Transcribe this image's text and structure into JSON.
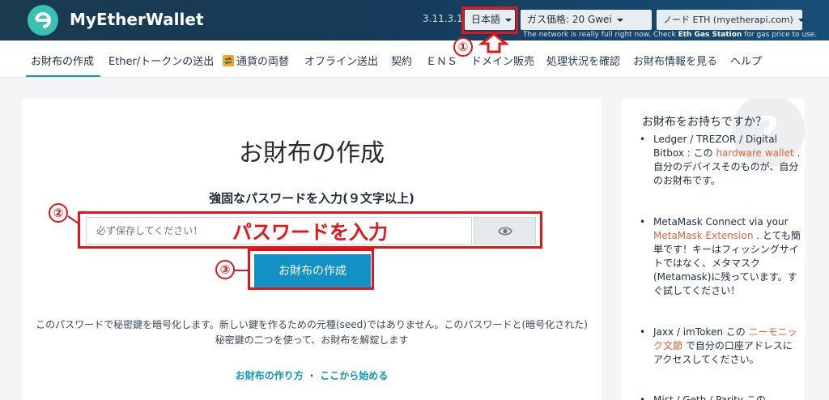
{
  "header": {
    "brand": "MyEtherWallet",
    "version": "3.11.3.1",
    "language": "日本語",
    "gas_price": "ガス価格: 20 Gwei",
    "node": "ノード ETH (myetherapi.com)",
    "gas_note_prefix": "The network is really full right now. Check ",
    "gas_note_link": "Eth Gas Station",
    "gas_note_suffix": " for gas price to use."
  },
  "nav": {
    "items": [
      "お財布の作成",
      "Ether/トークンの送出",
      "通貨の両替",
      "オフライン送出",
      "契約",
      "ＥＮＳ",
      "ドメイン販売",
      "処理状況を確認",
      "お財布情報を見る",
      "ヘルプ"
    ]
  },
  "main": {
    "title": "お財布の作成",
    "password_label": "強固なパスワードを入力(９文字以上)",
    "password_placeholder": "必ず保存してください！",
    "create_button": "お財布の作成",
    "description": "このパスワードで秘密鍵を暗号化します。新しい鍵を作るための元種(seed)ではありません。このパスワードと(暗号化された)秘密鍵の二つを使って、お財布を解錠します",
    "link_howto": "お財布の作り方",
    "link_separator": "·",
    "link_start": "ここから始める"
  },
  "annotations": {
    "num1": "①",
    "num2": "②",
    "num3": "③",
    "password_note": "パスワードを入力"
  },
  "sidebar": {
    "question_mark": "?",
    "title": "お財布をお持ちですか？",
    "bullet": "•",
    "item1_pre": "Ledger / TREZOR / Digital Bitbox : この ",
    "item1_link": "hardware wallet",
    "item1_post": " . 自分のデバイスそのものが、自分のお財布です。",
    "item2_pre": "MetaMask Connect via your ",
    "item2_link": "MetaMask Extension",
    "item2_post": " . とても簡単です！キーはフィッシングサイトではなく、メタマスク(Metamask)に残っています。すぐ試してください！",
    "item3_pre": "Jaxx / imToken この ",
    "item3_link": "ニーモニック文節",
    "item3_post": " で自分の口座アドレスにアクセスしてください。",
    "item4": "Mist / Geth / Parity この"
  },
  "colors": {
    "accent": "#0e97c0",
    "annotation_red": "#e0161c",
    "link_orange": "#e8603a"
  }
}
